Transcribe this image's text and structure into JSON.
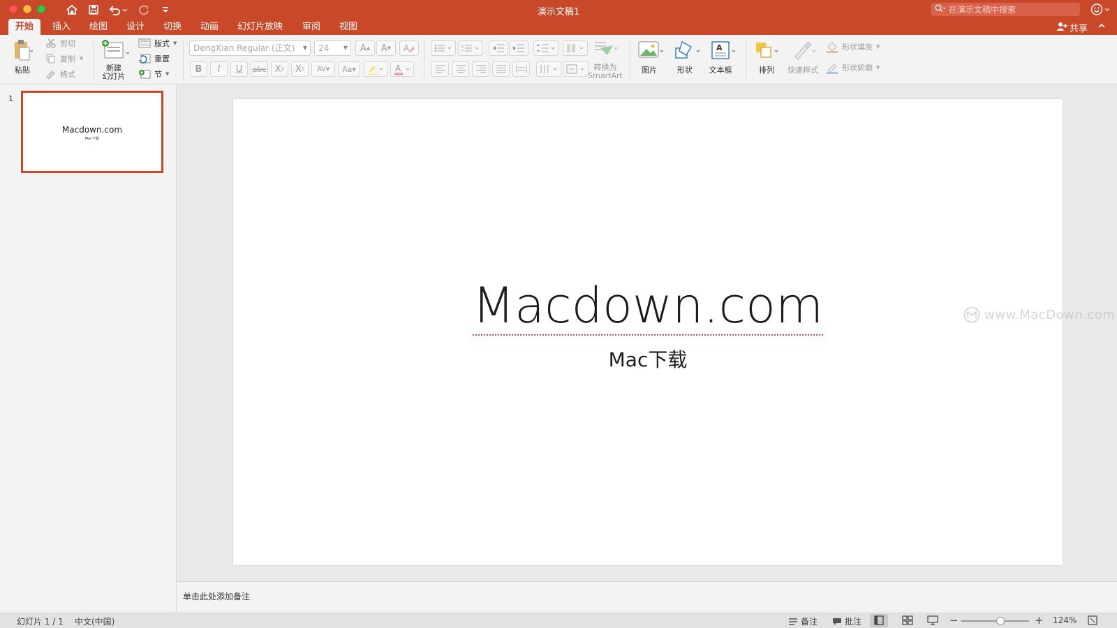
{
  "window": {
    "title": "演示文稿1",
    "search_placeholder": "在演示文稿中搜索"
  },
  "tabs": [
    "开始",
    "插入",
    "绘图",
    "设计",
    "切换",
    "动画",
    "幻灯片放映",
    "审阅",
    "视图"
  ],
  "share_label": "共享",
  "ribbon": {
    "paste": "粘贴",
    "cut": "剪切",
    "copy": "复制",
    "format": "格式",
    "new_slide": "新建\n幻灯片",
    "layout": "版式",
    "reset": "重置",
    "section": "节",
    "font_name": "DengXian Regular (正文)",
    "font_size": "24",
    "convert_smartart_line1": "转换为",
    "convert_smartart_line2": "SmartArt",
    "picture": "图片",
    "shape": "形状",
    "textbox": "文本框",
    "arrange": "排列",
    "quick_styles": "快速样式",
    "shape_fill": "形状填充",
    "shape_outline": "形状轮廓"
  },
  "slides": [
    {
      "number": "1",
      "title": "Macdown.com",
      "subtitle": "Mac下载"
    }
  ],
  "slide_content": {
    "title": "Macdown.com",
    "subtitle": "Mac下载"
  },
  "watermark": "www.MacDown.com",
  "notes_placeholder": "单击此处添加备注",
  "status": {
    "slide_counter": "幻灯片 1 / 1",
    "language": "中文(中国)",
    "notes": "备注",
    "comments": "批注",
    "zoom": "124%",
    "zoom_level": 0.58
  },
  "colors": {
    "accent": "#c9482a",
    "background": "#f3f3f3"
  }
}
